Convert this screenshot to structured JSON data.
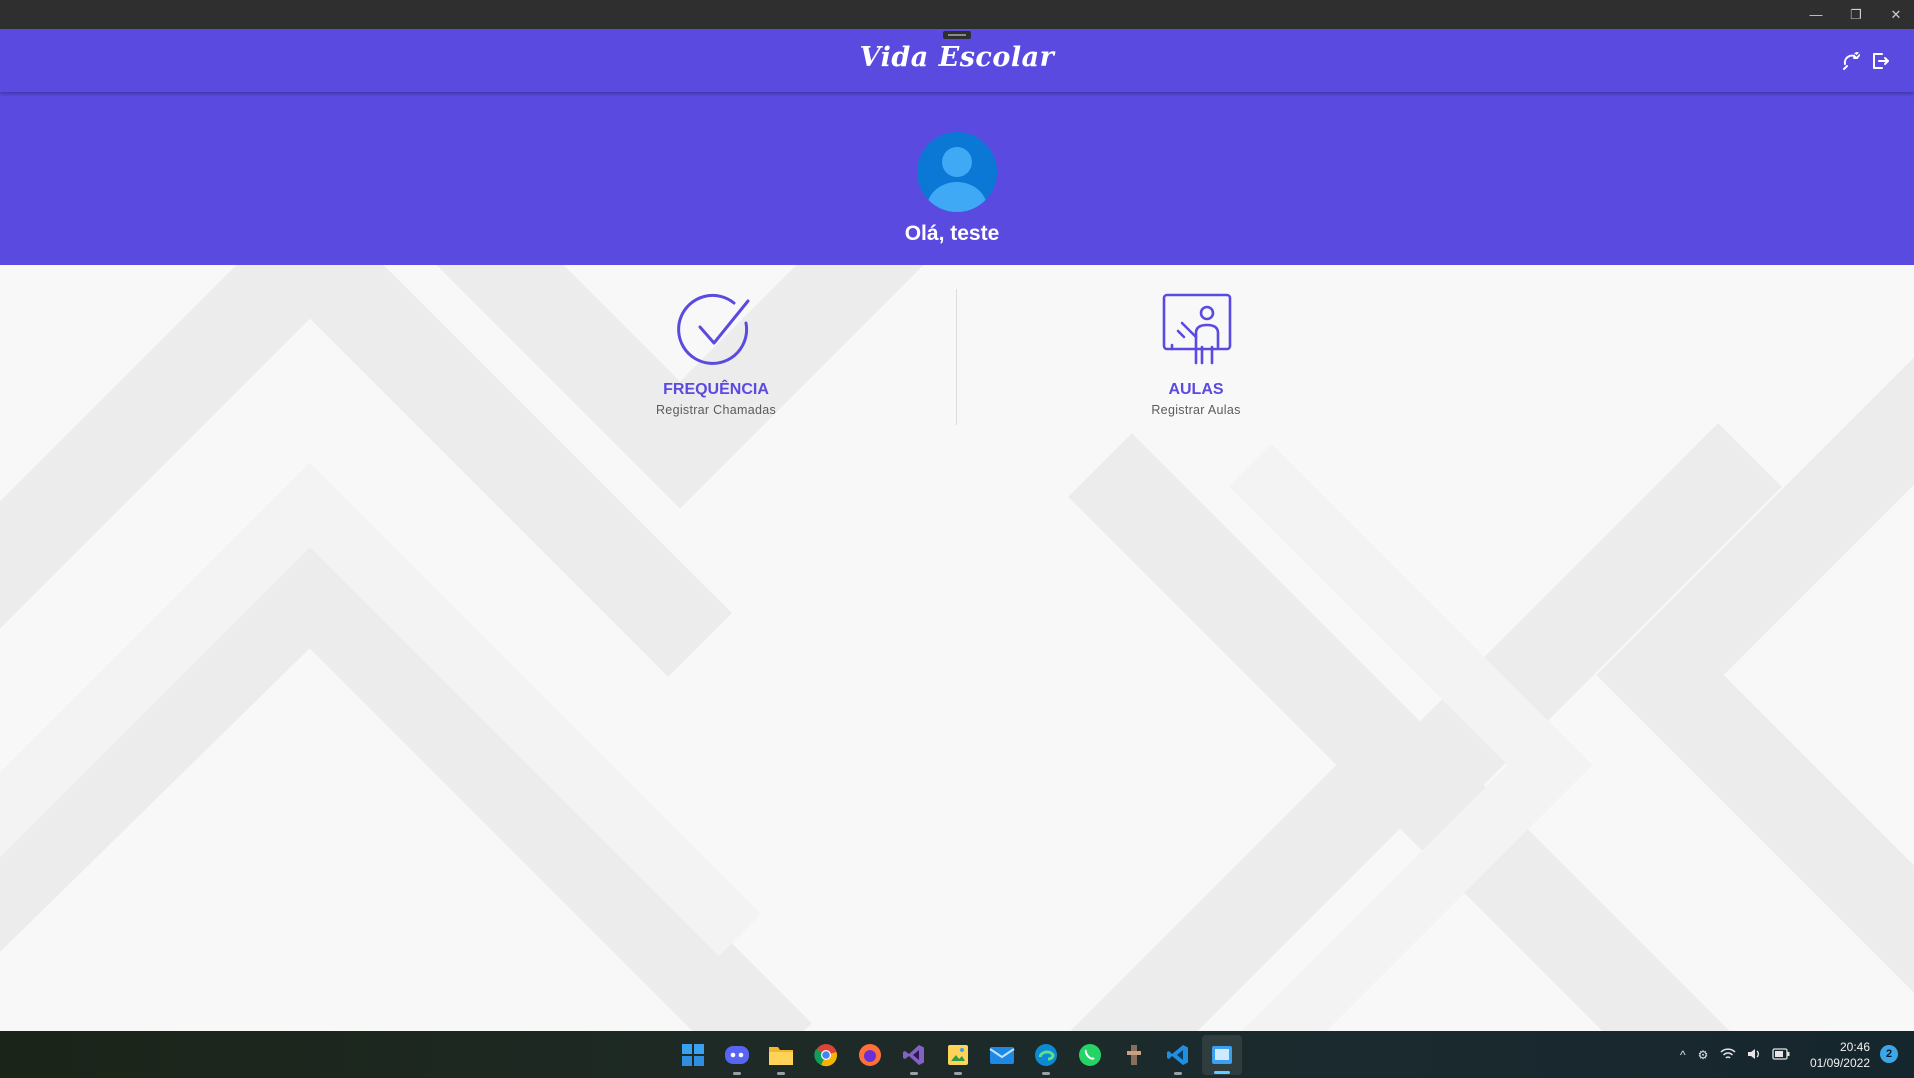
{
  "window": {
    "minimize_glyph": "—",
    "restore_glyph": "❐",
    "close_glyph": "✕"
  },
  "header": {
    "brand": "Vida Escolar",
    "icons": [
      "sync-icon",
      "logout-icon"
    ]
  },
  "profile": {
    "greeting": "Olá, teste",
    "avatar_icon": "user-avatar-icon"
  },
  "cards": [
    {
      "title": "FREQUÊNCIA",
      "subtitle": "Registrar Chamadas",
      "icon": "check-circle-icon"
    },
    {
      "title": "AULAS",
      "subtitle": "Registrar Aulas",
      "icon": "teacher-board-icon"
    }
  ],
  "colors": {
    "brand": "#5a4ae0",
    "avatar": "#0a78d4"
  },
  "taskbar": {
    "apps": [
      "windows-start-icon",
      "discord-icon",
      "file-explorer-icon",
      "chrome-icon",
      "firefox-icon",
      "visual-studio-icon",
      "image-app-icon",
      "mail-icon",
      "edge-icon",
      "whatsapp-icon",
      "app-icon",
      "vscode-icon",
      "emulator-icon"
    ],
    "time": "20:46",
    "date": "01/09/2022",
    "notifications": "2"
  }
}
